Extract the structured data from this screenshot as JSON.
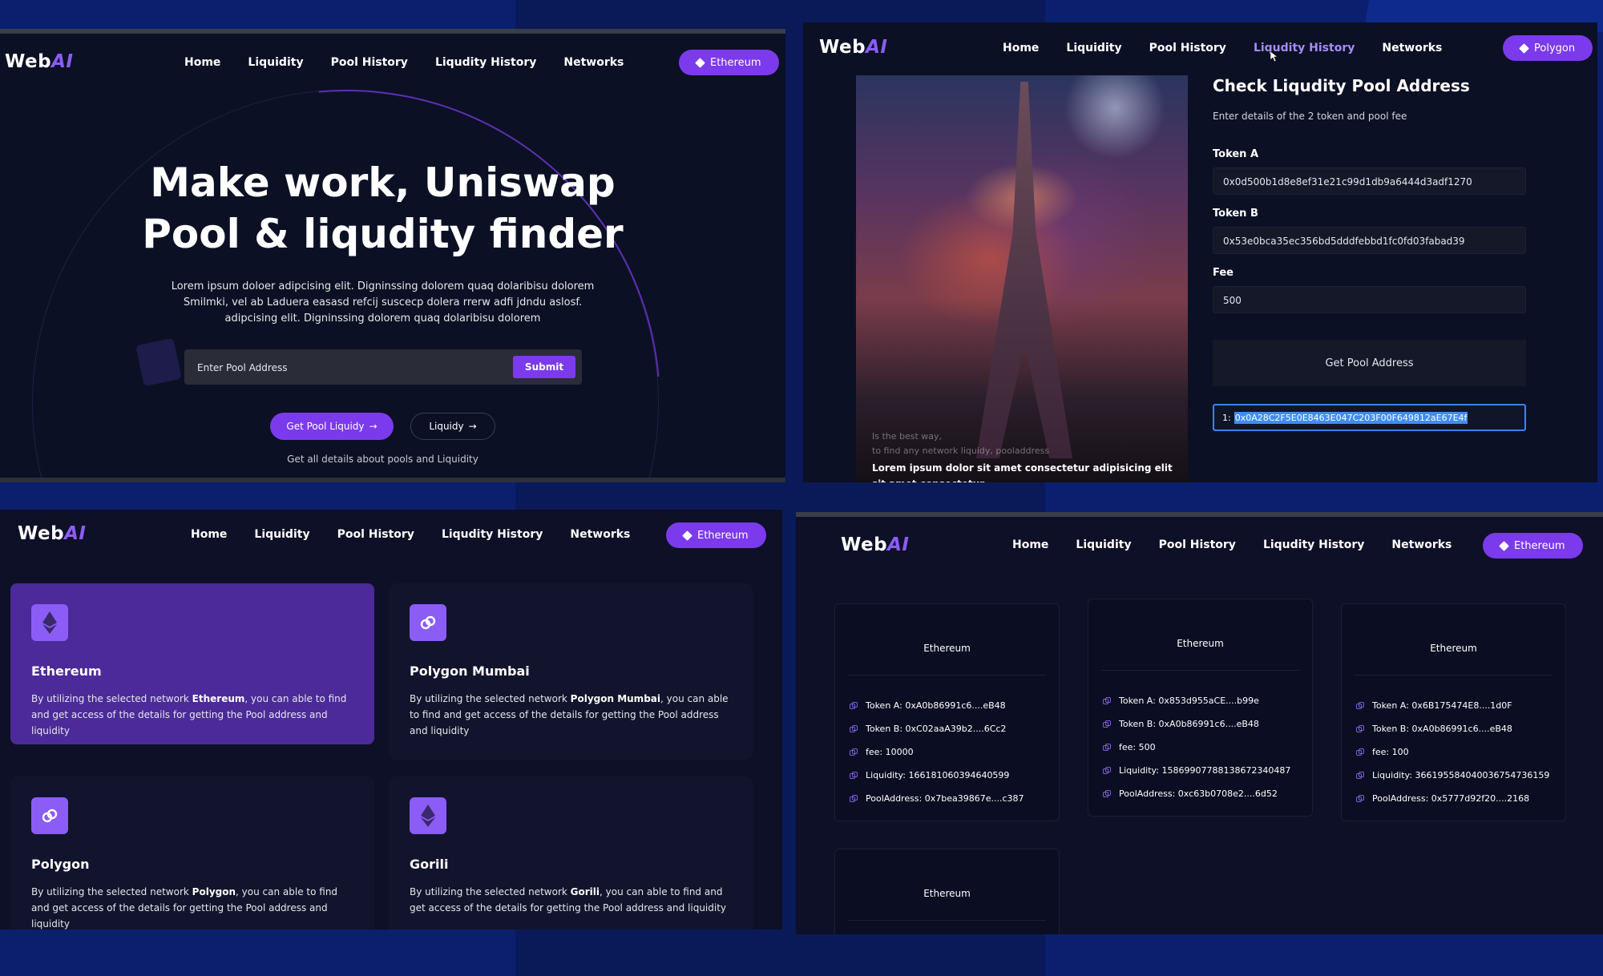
{
  "nav": {
    "logo_text": "Web",
    "logo_accent": "AI",
    "links": [
      "Home",
      "Liquidity",
      "Pool History",
      "Liqudity History",
      "Networks"
    ]
  },
  "hero": {
    "network_button": "Ethereum",
    "title_line1": "Make work, Uniswap",
    "title_line2": "Pool & liqudity finder",
    "description": "Lorem ipsum doloer adipcising elit. Digninssing dolorem quaq dolaribisu dolorem Smilmki, vel ab Laduera easasd refcij suscecp dolera rrerw adfi jdndu aslosf. adipcising elit. Digninssing dolorem quaq dolaribisu dolorem",
    "search_placeholder": "Enter Pool Address",
    "submit_label": "Submit",
    "primary_button": "Get Pool Liquidy",
    "secondary_button": "Liquidy",
    "caption": "Get all details about pools and Liquidity"
  },
  "check": {
    "network_button": "Polygon",
    "active_link": "Liqudity History",
    "title": "Check Liqudity Pool Address",
    "subtitle": "Enter details of the 2 token and pool fee",
    "token_a_label": "Token A",
    "token_a_value": "0x0d500b1d8e8ef31e21c99d1db9a6444d3adf1270",
    "token_b_label": "Token B",
    "token_b_value": "0x53e0bca35ec356bd5dddfebbd1fc0fd03fabad39",
    "fee_label": "Fee",
    "fee_value": "500",
    "button_label": "Get Pool Address",
    "result_prefix": "1:",
    "result_value": "0x0A28C2F5E0E8463E047C203F00F649812aE67E4f",
    "image_faded_line1": "Is the best way,",
    "image_faded_line2": "to find any network liquidy, pooladdress",
    "image_text": "Lorem ipsum dolor sit amet consectetur adipisicing elit sit amet consectetur."
  },
  "networks": {
    "network_button": "Ethereum",
    "desc_prefix": "By utilizing the selected network",
    "cards": [
      {
        "name": "Ethereum",
        "suffix": ", you can able to find and get access of the details for getting the Pool address and liquidity",
        "icon": "ethereum-icon"
      },
      {
        "name": "Polygon Mumbai",
        "suffix": ", you can able to find and get access of the details for getting the Pool address and liquidity",
        "icon": "polygon-icon"
      },
      {
        "name": "Polygon",
        "suffix": ", you can able to find and get access of the details for getting the Pool address and liquidity",
        "icon": "polygon-icon"
      },
      {
        "name": "Gorili",
        "suffix": ", you can able to find and get access of the details for getting the Pool address and liquidity",
        "icon": "ethereum-icon"
      }
    ]
  },
  "pools": {
    "network_button": "Ethereum",
    "cards": [
      {
        "network": "Ethereum",
        "rows": [
          "Token A: 0xA0b86991c6....eB48",
          "Token B: 0xC02aaA39b2....6Cc2",
          "fee: 10000",
          "Liquidity: 166181060394640599",
          "PoolAddress: 0x7bea39867e....c387"
        ]
      },
      {
        "network": "Ethereum",
        "rows": [
          "Token A: 0x853d955aCE....b99e",
          "Token B: 0xA0b86991c6....eB48",
          "fee: 500",
          "Liquidity: 1586990778813867234048​7",
          "PoolAddress: 0xc63b0708e2....6d52"
        ]
      },
      {
        "network": "Ethereum",
        "rows": [
          "Token A: 0x6B175474E8....1d0F",
          "Token B: 0xA0b86991c6....eB48",
          "fee: 100",
          "Liquidity: 366195584040036754736159",
          "PoolAddress: 0x5777d92f20....2168"
        ]
      },
      {
        "network": "Ethereum",
        "rows": []
      }
    ]
  },
  "colors": {
    "accent": "#7c3aed",
    "panel_bg": "#0c1024",
    "page_bg": "#0b1f6e",
    "selected_card": "#4c2a9a",
    "focus_blue": "#3b82f6"
  }
}
